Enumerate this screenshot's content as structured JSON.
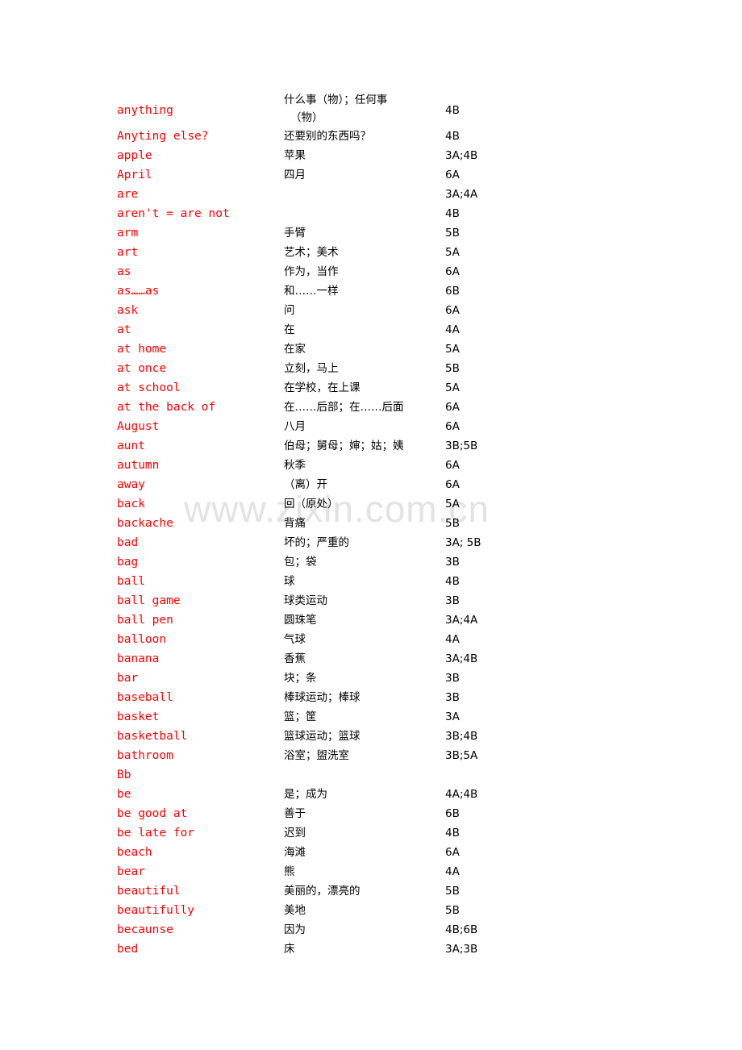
{
  "watermark": {
    "text": "www.zixin.com.cn",
    "color": "#e3e3e3"
  },
  "theme": {
    "term_color": "#ff0000",
    "text_color": "#000000",
    "background": "#ffffff"
  },
  "glossary": {
    "columns": [
      "term",
      "gloss",
      "level"
    ],
    "rows": [
      {
        "term": "anything",
        "gloss": "什么事（物）；任何事",
        "gloss2": "（物）",
        "level": "4B"
      },
      {
        "term": "Anyting else?",
        "gloss": "还要别的东西吗？",
        "level": "4B"
      },
      {
        "term": "apple",
        "gloss": "苹果",
        "level": "3A;4B"
      },
      {
        "term": "April",
        "gloss": "四月",
        "level": "6A"
      },
      {
        "term": "are",
        "gloss": "",
        "level": "3A;4A"
      },
      {
        "term": "aren't = are not",
        "gloss": "",
        "level": "4B"
      },
      {
        "term": "arm",
        "gloss": "手臂",
        "level": "5B"
      },
      {
        "term": "art",
        "gloss": "艺术；美术",
        "level": "5A"
      },
      {
        "term": "as",
        "gloss": "作为，当作",
        "level": "6A"
      },
      {
        "term": "as……as",
        "gloss": "和……一样",
        "level": "6B"
      },
      {
        "term": "ask",
        "gloss": "问",
        "level": "6A"
      },
      {
        "term": "at",
        "gloss": "在",
        "level": "4A"
      },
      {
        "term": "at home",
        "gloss": "在家",
        "level": "5A"
      },
      {
        "term": "at once",
        "gloss": "立刻，马上",
        "level": "5B"
      },
      {
        "term": "at school",
        "gloss": "在学校，在上课",
        "level": "5A"
      },
      {
        "term": "at the back of",
        "gloss": "在……后部；在……后面",
        "level": "6A"
      },
      {
        "term": "August",
        "gloss": "八月",
        "level": "6A"
      },
      {
        "term": "aunt",
        "gloss": "伯母；舅母；婶；姑；姨",
        "level": "3B;5B"
      },
      {
        "term": "autumn",
        "gloss": "秋季",
        "level": "6A"
      },
      {
        "term": "away",
        "gloss": "（离）开",
        "level": "6A"
      },
      {
        "term": "back",
        "gloss": "回（原处）",
        "level": "5A"
      },
      {
        "term": "backache",
        "gloss": "背痛",
        "level": "5B"
      },
      {
        "term": "bad",
        "gloss": "坏的；严重的",
        "level": "3A; 5B"
      },
      {
        "term": "bag",
        "gloss": "包；袋",
        "level": "3B"
      },
      {
        "term": "ball",
        "gloss": "球",
        "level": "4B"
      },
      {
        "term": "ball game",
        "gloss": "球类运动",
        "level": "3B"
      },
      {
        "term": "ball pen",
        "gloss": "圆珠笔",
        "level": "3A;4A"
      },
      {
        "term": "balloon",
        "gloss": "气球",
        "level": "4A"
      },
      {
        "term": "banana",
        "gloss": "香蕉",
        "level": "3A;4B"
      },
      {
        "term": "bar",
        "gloss": "块；条",
        "level": "3B"
      },
      {
        "term": "baseball",
        "gloss": "棒球运动；棒球",
        "level": "3B"
      },
      {
        "term": "basket",
        "gloss": "篮；筐",
        "level": "3A"
      },
      {
        "term": "basketball",
        "gloss": "篮球运动；篮球",
        "level": "3B;4B"
      },
      {
        "term": "bathroom",
        "gloss": "浴室；盥洗室",
        "level": "3B;5A"
      },
      {
        "term": "Bb",
        "gloss": "",
        "level": ""
      },
      {
        "term": "be",
        "gloss": "是；成为",
        "level": "4A;4B"
      },
      {
        "term": "be good at",
        "gloss": "善于",
        "level": "6B"
      },
      {
        "term": "be late for",
        "gloss": "迟到",
        "level": "4B"
      },
      {
        "term": "beach",
        "gloss": "海滩",
        "level": "6A"
      },
      {
        "term": "bear",
        "gloss": "熊",
        "level": "4A"
      },
      {
        "term": "beautiful",
        "gloss": "美丽的，漂亮的",
        "level": "5B"
      },
      {
        "term": "beautifully",
        "gloss": "美地",
        "level": "5B"
      },
      {
        "term": "becaunse",
        "gloss": "因为",
        "level": "4B;6B"
      },
      {
        "term": "bed",
        "gloss": "床",
        "level": "3A;3B"
      }
    ]
  }
}
